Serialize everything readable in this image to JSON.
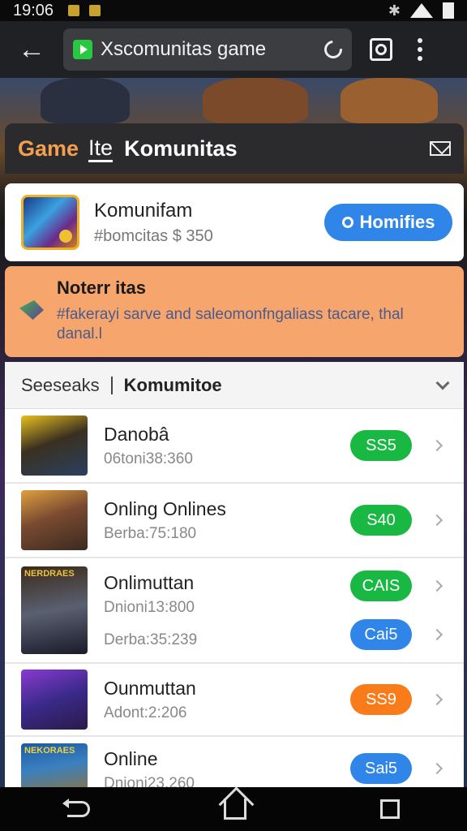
{
  "status_bar": {
    "time": "19:06"
  },
  "browser": {
    "url": "Xscomunitas game"
  },
  "header": {
    "game_label": "Game",
    "tab_label": "Ite",
    "title": "Komunitas"
  },
  "profile": {
    "name": "Komunifam",
    "subtitle": "#bomcitas $ 350",
    "home_button": "Homifies"
  },
  "notice": {
    "title": "Noterr itas",
    "body": "#fakerayi sarve and saleomonfngaliass tacare, thal danal.l"
  },
  "list": {
    "header_left": "Seeseaks",
    "header_right": "Komumitoe",
    "rows": [
      {
        "title": "Danobâ",
        "lines": [
          "06toni38:360"
        ],
        "badges": [
          {
            "label": "SS5",
            "color": "#18b843"
          }
        ],
        "thumb": "warrior"
      },
      {
        "title": "Onling Onlines",
        "lines": [
          "Berba:75:180"
        ],
        "badges": [
          {
            "label": "S40",
            "color": "#18b843"
          }
        ],
        "thumb": "bearded-hero"
      },
      {
        "title": "Onlimuttan",
        "lines": [
          "Dnioni13:800",
          "Derba:35:239"
        ],
        "badges": [
          {
            "label": "CAIS",
            "color": "#18b843"
          },
          {
            "label": "Cai5",
            "color": "#2f86e8"
          }
        ],
        "thumb": "soldier"
      },
      {
        "title": "Ounmuttan",
        "lines": [
          "Adont:2:206"
        ],
        "badges": [
          {
            "label": "SS9",
            "color": "#f97b1a"
          }
        ],
        "thumb": "mage"
      },
      {
        "title": "Online",
        "lines": [
          "Dnioni23.260"
        ],
        "badges": [
          {
            "label": "Sai5",
            "color": "#2f86e8"
          }
        ],
        "thumb": "heroes-poster"
      }
    ]
  },
  "thumb_labels": {
    "soldier": "NERDRAES",
    "poster": "NEKORAES"
  },
  "colors": {
    "accent_orange": "#f3a04c",
    "notice_bg": "#f6a56c",
    "primary_blue": "#2f86e8",
    "green": "#18b843"
  }
}
